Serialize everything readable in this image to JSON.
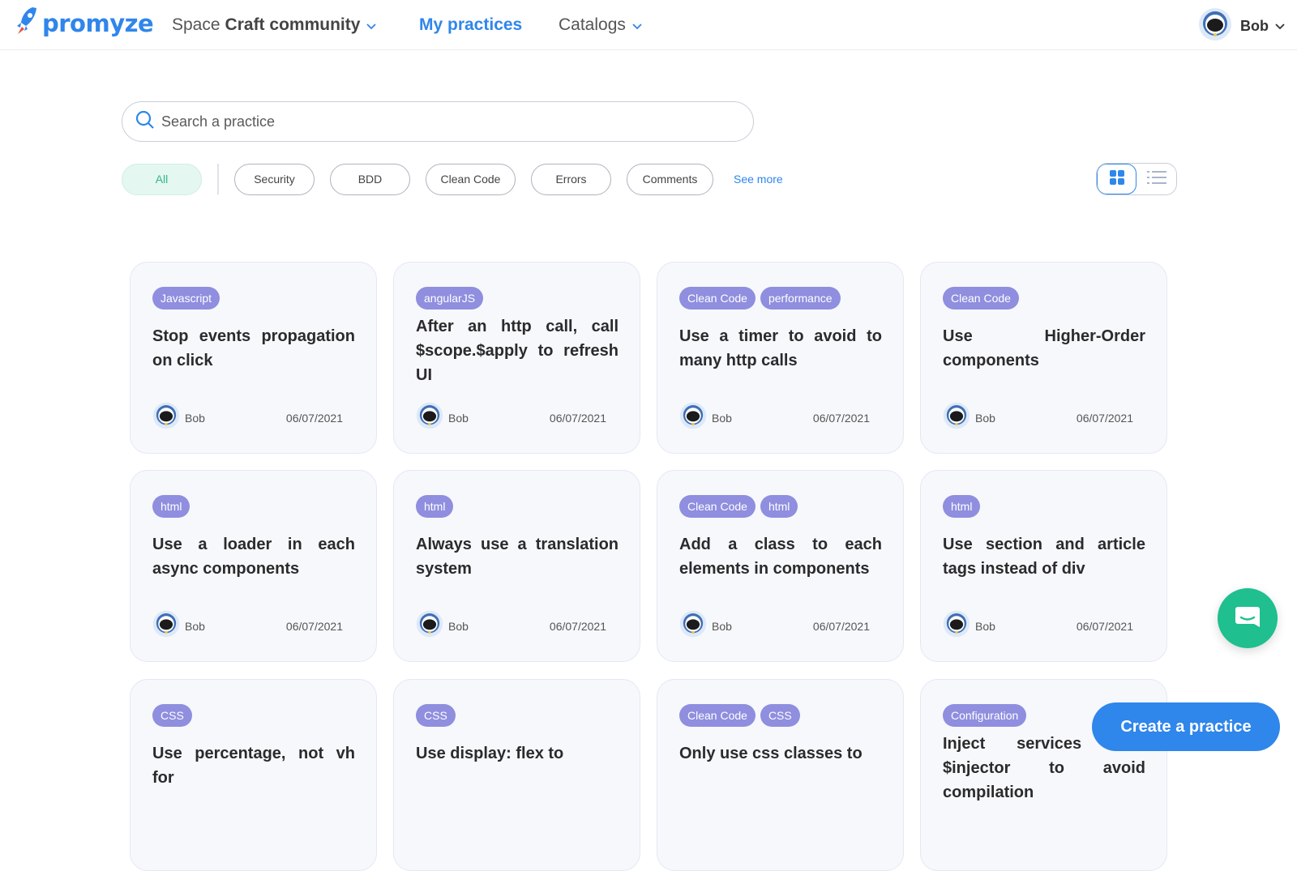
{
  "header": {
    "logo": "promyze",
    "community_prefix": "Space",
    "community_name": "Craft community",
    "nav_practices": "My practices",
    "nav_catalogs": "Catalogs",
    "user_name": "Bob"
  },
  "search": {
    "placeholder": "Search a practice"
  },
  "filters": {
    "all": "All",
    "chips": [
      "Security",
      "BDD",
      "Clean Code",
      "Errors",
      "Comments"
    ],
    "see_more": "See more"
  },
  "colors": {
    "accent": "#2f86eb",
    "tag": "#8f8edf",
    "active_chip": "#2fb887",
    "chat": "#1fbf8f"
  },
  "cards": [
    {
      "tags": [
        "Javascript"
      ],
      "title": "Stop events propagation on click",
      "author": "Bob",
      "date": "06/07/2021"
    },
    {
      "tags": [
        "angularJS"
      ],
      "title": "After an http call, call $scope.$apply to refresh UI",
      "author": "Bob",
      "date": "06/07/2021"
    },
    {
      "tags": [
        "Clean Code",
        "performance"
      ],
      "title": "Use a timer to avoid to many http calls",
      "author": "Bob",
      "date": "06/07/2021"
    },
    {
      "tags": [
        "Clean Code"
      ],
      "title": "Use Higher-Order components",
      "author": "Bob",
      "date": "06/07/2021"
    },
    {
      "tags": [
        "html"
      ],
      "title": "Use a loader in each async components",
      "author": "Bob",
      "date": "06/07/2021"
    },
    {
      "tags": [
        "html"
      ],
      "title": "Always use a translation system",
      "author": "Bob",
      "date": "06/07/2021"
    },
    {
      "tags": [
        "Clean Code",
        "html"
      ],
      "title": "Add a class to each elements in components",
      "author": "Bob",
      "date": "06/07/2021"
    },
    {
      "tags": [
        "html"
      ],
      "title": "Use section and article tags instead of div",
      "author": "Bob",
      "date": "06/07/2021"
    },
    {
      "tags": [
        "CSS"
      ],
      "title": "Use percentage, not vh for",
      "author": "",
      "date": ""
    },
    {
      "tags": [
        "CSS"
      ],
      "title": "Use display: flex to",
      "author": "",
      "date": ""
    },
    {
      "tags": [
        "Clean Code",
        "CSS"
      ],
      "title": "Only use css classes to",
      "author": "",
      "date": ""
    },
    {
      "tags": [
        "Configuration"
      ],
      "title": "Inject services with $injector to avoid compilation",
      "author": "",
      "date": ""
    }
  ],
  "actions": {
    "create_practice": "Create a practice"
  }
}
